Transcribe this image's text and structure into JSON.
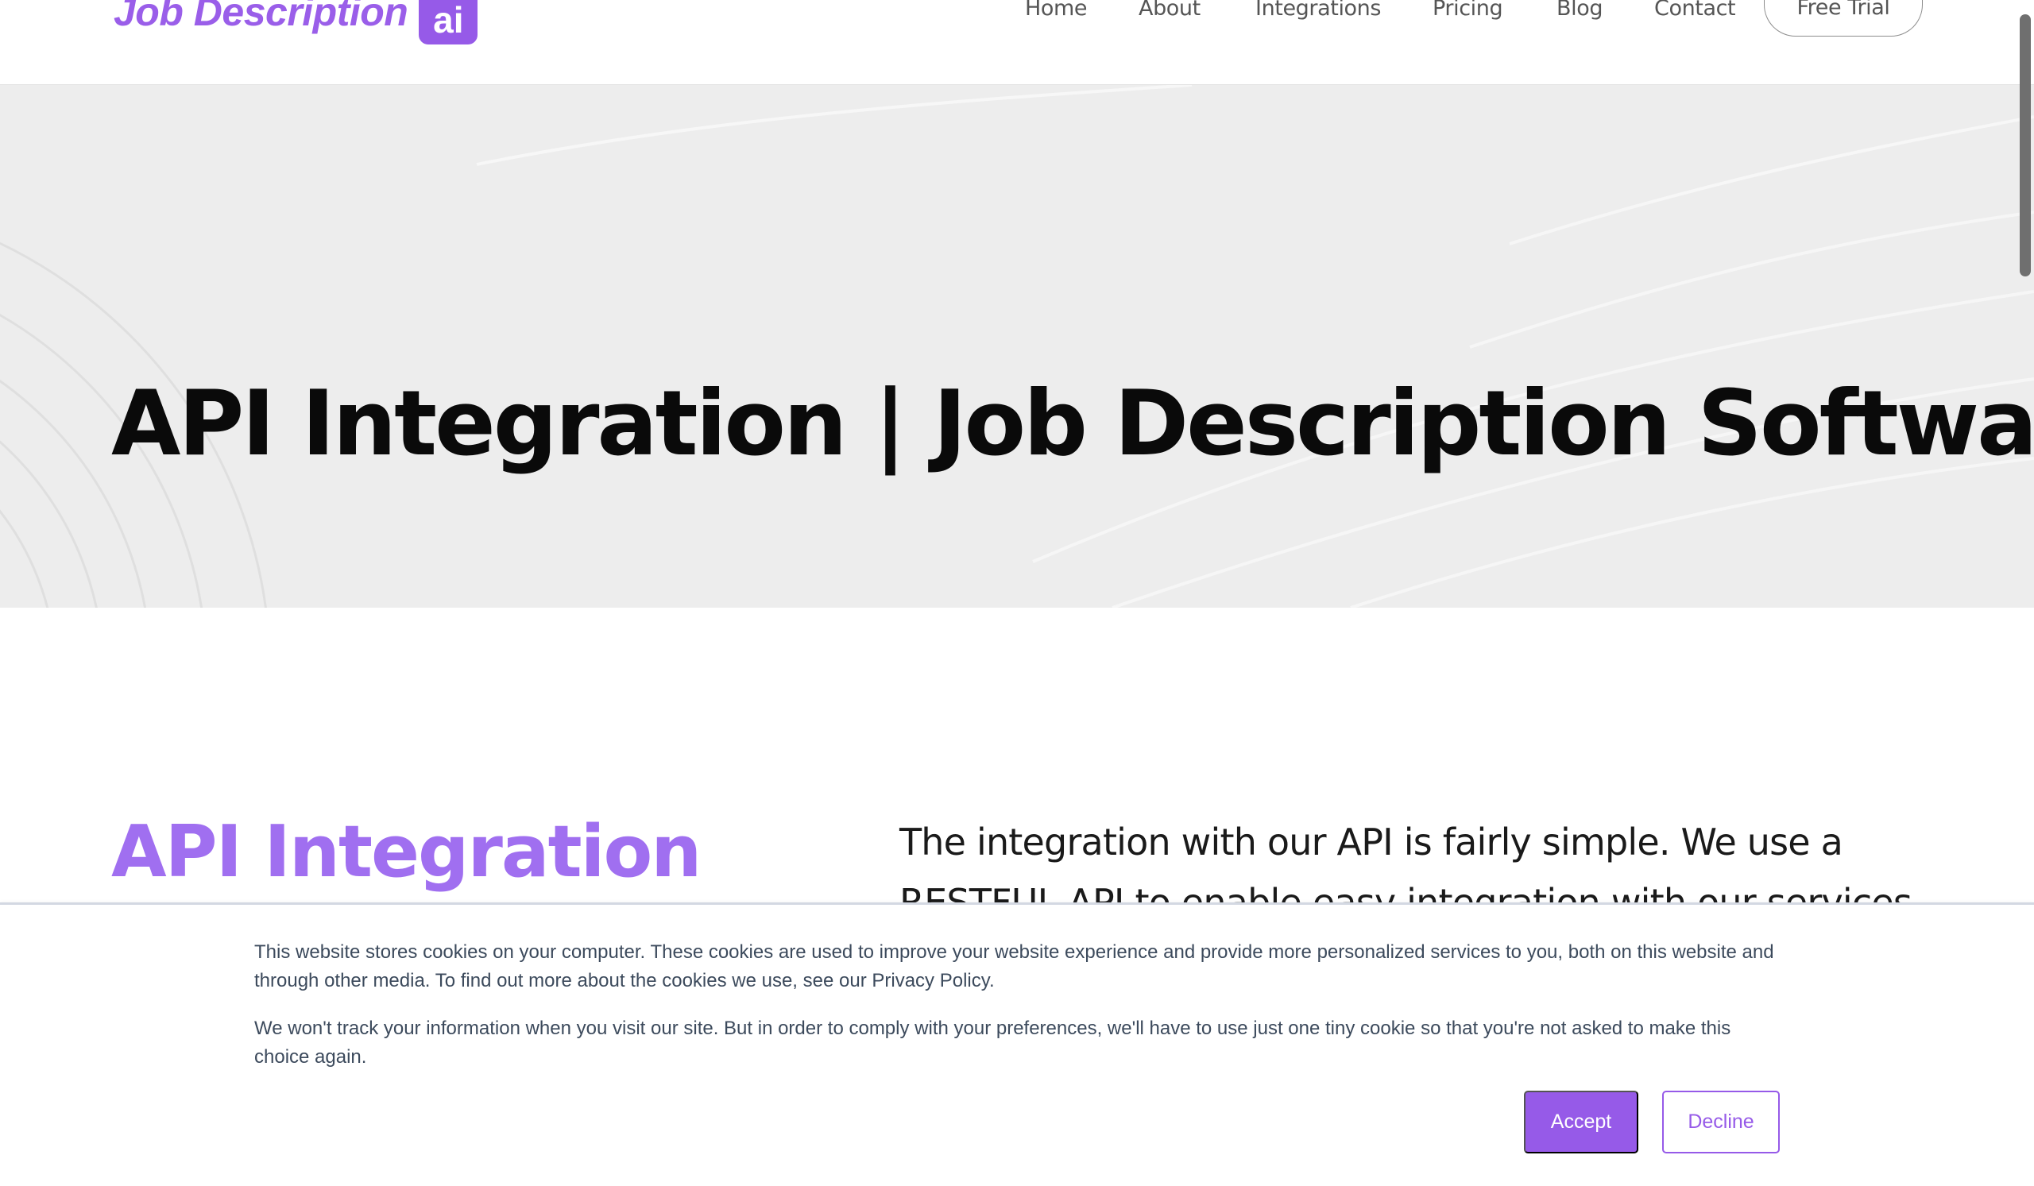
{
  "header": {
    "logo": {
      "text": "Job Description",
      "badge": "ai"
    },
    "nav": [
      {
        "label": "Home"
      },
      {
        "label": "About"
      },
      {
        "label": "Integrations"
      },
      {
        "label": "Pricing"
      },
      {
        "label": "Blog"
      },
      {
        "label": "Contact"
      }
    ],
    "cta_label": "Free Trial"
  },
  "hero": {
    "title": "API Integration | Job Description Software"
  },
  "main": {
    "heading": "API Integration",
    "intro": "The integration with our API is fairly simple. We use a RESTFUL API to enable easy integration with our services"
  },
  "cookie_banner": {
    "paragraph_1": "This website stores cookies on your computer. These cookies are used to improve your website experience and provide more personalized services to you, both on this website and through other media. To find out more about the cookies we use, see our Privacy Policy.",
    "paragraph_2": "We won't track your information when you visit our site. But in order to comply with your preferences, we'll have to use just one tiny cookie so that you're not asked to make this choice again.",
    "accept_label": "Accept",
    "decline_label": "Decline"
  },
  "colors": {
    "brand": "#965ae8",
    "heading_accent": "#a06ff0",
    "hero_bg": "#ededed",
    "cookie_text": "#3c4a5c"
  }
}
